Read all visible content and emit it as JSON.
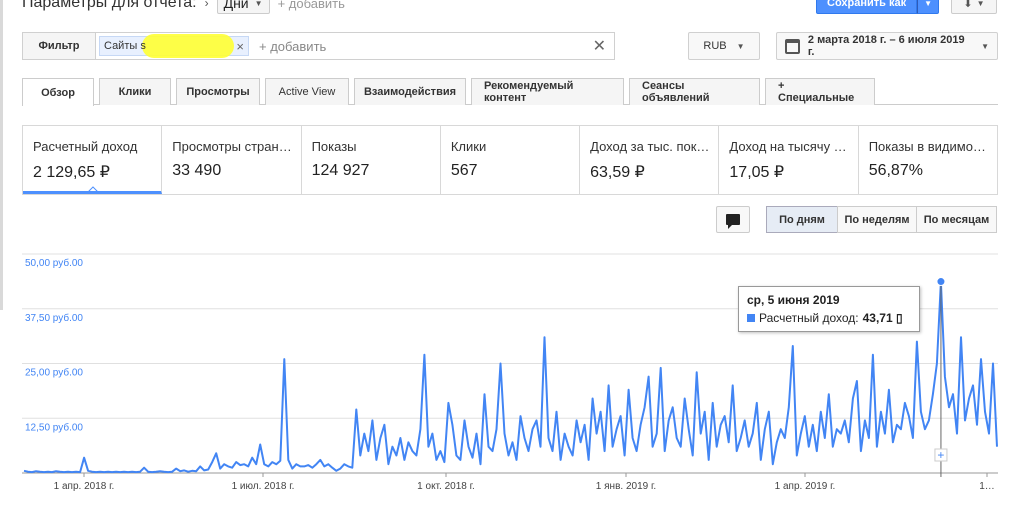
{
  "header": {
    "report_title": "Параметры для отчета:",
    "dimension_value": "Дни",
    "add_label": "+ добавить",
    "save_label": "Сохранить как"
  },
  "filter": {
    "label": "Фильтр",
    "chip_text": "Сайты s",
    "add_placeholder": "+ добавить"
  },
  "currency": {
    "value": "RUB"
  },
  "date_range": {
    "value": "2 марта 2018 г. – 6 июля 2019 г."
  },
  "tabs": [
    {
      "label": "Обзор"
    },
    {
      "label": "Клики"
    },
    {
      "label": "Просмотры"
    },
    {
      "label": "Active View"
    },
    {
      "label": "Взаимодействия"
    },
    {
      "label": "Рекомендуемый контент"
    },
    {
      "label": "Сеансы объявлений"
    },
    {
      "label": "+  Специальные"
    }
  ],
  "metrics": [
    {
      "label": "Расчетный доход",
      "value": "2 129,65 ₽"
    },
    {
      "label": "Просмотры стран…",
      "value": "33 490"
    },
    {
      "label": "Показы",
      "value": "124 927"
    },
    {
      "label": "Клики",
      "value": "567"
    },
    {
      "label": "Доход за тыс. пок…",
      "value": "63,59 ₽"
    },
    {
      "label": "Доход на тысячу …",
      "value": "17,05 ₽"
    },
    {
      "label": "Показы в видимо…",
      "value": "56,87%"
    }
  ],
  "granularity": [
    {
      "label": "По дням"
    },
    {
      "label": "По неделям"
    },
    {
      "label": "По месяцам"
    }
  ],
  "tooltip": {
    "date": "ср, 5 июня 2019",
    "series_label": "Расчетный доход:",
    "value": "43,71 ▯"
  },
  "colors": {
    "accent": "#4285f4",
    "primary_button": "#4d90fe",
    "highlight": "#ffff33"
  },
  "chart_data": {
    "type": "line",
    "series": [
      {
        "name": "Расчетный доход",
        "values": [
          0.5,
          0.3,
          0.2,
          0.4,
          0.3,
          0.2,
          0.3,
          0.2,
          0.4,
          0.3,
          0.2,
          0.3,
          0.2,
          0.3,
          0.2,
          3.5,
          0.5,
          0.3,
          0.2,
          0.3,
          0.2,
          0.3,
          0.2,
          0.3,
          0.2,
          0.3,
          0.2,
          0.3,
          0.2,
          0.3,
          1.2,
          0.3,
          0.2,
          0.3,
          0.4,
          0.3,
          0.2,
          0.3,
          1.0,
          0.4,
          0.6,
          0.3,
          0.5,
          0.4,
          1.5,
          0.6,
          0.8,
          2.5,
          4.5,
          1.0,
          2.0,
          1.5,
          1.2,
          2.5,
          1.8,
          2.0,
          1.5,
          3.5,
          2.0,
          6.5,
          2.0,
          1.5,
          2.5,
          2.0,
          2.8,
          26.0,
          3.0,
          1.0,
          2.0,
          1.5,
          1.5,
          1.8,
          1.2,
          2.0,
          3.0,
          1.5,
          2.0,
          1.2,
          0.5,
          1.0,
          2.0,
          1.5,
          1.2,
          14.5,
          4.0,
          9.0,
          5.0,
          12.0,
          3.0,
          8.0,
          11.0,
          2.0,
          6.0,
          4.0,
          8.0,
          3.0,
          7.0,
          5.0,
          4.0,
          10.0,
          27.0,
          6.0,
          9.0,
          3.0,
          5.0,
          2.5,
          16.0,
          11.0,
          4.0,
          3.0,
          12.0,
          6.0,
          3.5,
          9.0,
          2.0,
          18.0,
          6.0,
          5.0,
          10.0,
          25.0,
          9.0,
          4.0,
          7.0,
          3.0,
          13.0,
          8.0,
          5.0,
          10.0,
          12.0,
          6.0,
          31.0,
          8.0,
          5.0,
          14.0,
          3.0,
          9.0,
          6.0,
          4.0,
          12.0,
          7.0,
          11.0,
          3.0,
          17.0,
          9.0,
          14.0,
          5.0,
          20.0,
          6.0,
          10.0,
          13.0,
          4.0,
          19.0,
          8.0,
          5.0,
          11.0,
          15.0,
          22.0,
          6.0,
          9.0,
          24.0,
          5.0,
          12.0,
          15.0,
          8.0,
          6.0,
          17.0,
          10.0,
          4.0,
          23.0,
          9.0,
          14.0,
          3.0,
          16.0,
          6.0,
          11.0,
          13.0,
          7.0,
          20.0,
          5.0,
          8.0,
          12.0,
          6.0,
          9.0,
          16.0,
          3.0,
          10.0,
          14.0,
          2.0,
          7.0,
          10.0,
          8.0,
          15.0,
          29.0,
          4.0,
          9.0,
          13.0,
          6.0,
          11.0,
          5.0,
          14.0,
          8.0,
          18.0,
          6.0,
          10.0,
          9.0,
          12.0,
          7.0,
          17.0,
          21.0,
          5.0,
          12.0,
          8.0,
          27.0,
          6.0,
          14.0,
          9.0,
          19.0,
          7.0,
          11.0,
          10.0,
          16.0,
          13.0,
          8.0,
          30.0,
          14.0,
          10.0,
          12.0,
          18.0,
          25.0,
          43.71,
          22.0,
          15.0,
          18.0,
          9.0,
          31.0,
          12.0,
          17.0,
          20.0,
          11.0,
          26.0,
          14.0,
          9.0,
          25.0,
          6.0
        ]
      }
    ],
    "x_tick_labels": [
      "1 апр. 2018 г.",
      "1 июл. 2018 г.",
      "1 окт. 2018 г.",
      "1 янв. 2019 г.",
      "1 апр. 2019 г.",
      "1…"
    ],
    "y_tick_labels": [
      "12,50 руб.00",
      "25,00 руб.00",
      "37,50 руб.00",
      "50,00 руб.00"
    ],
    "ylim": [
      0,
      50
    ]
  }
}
